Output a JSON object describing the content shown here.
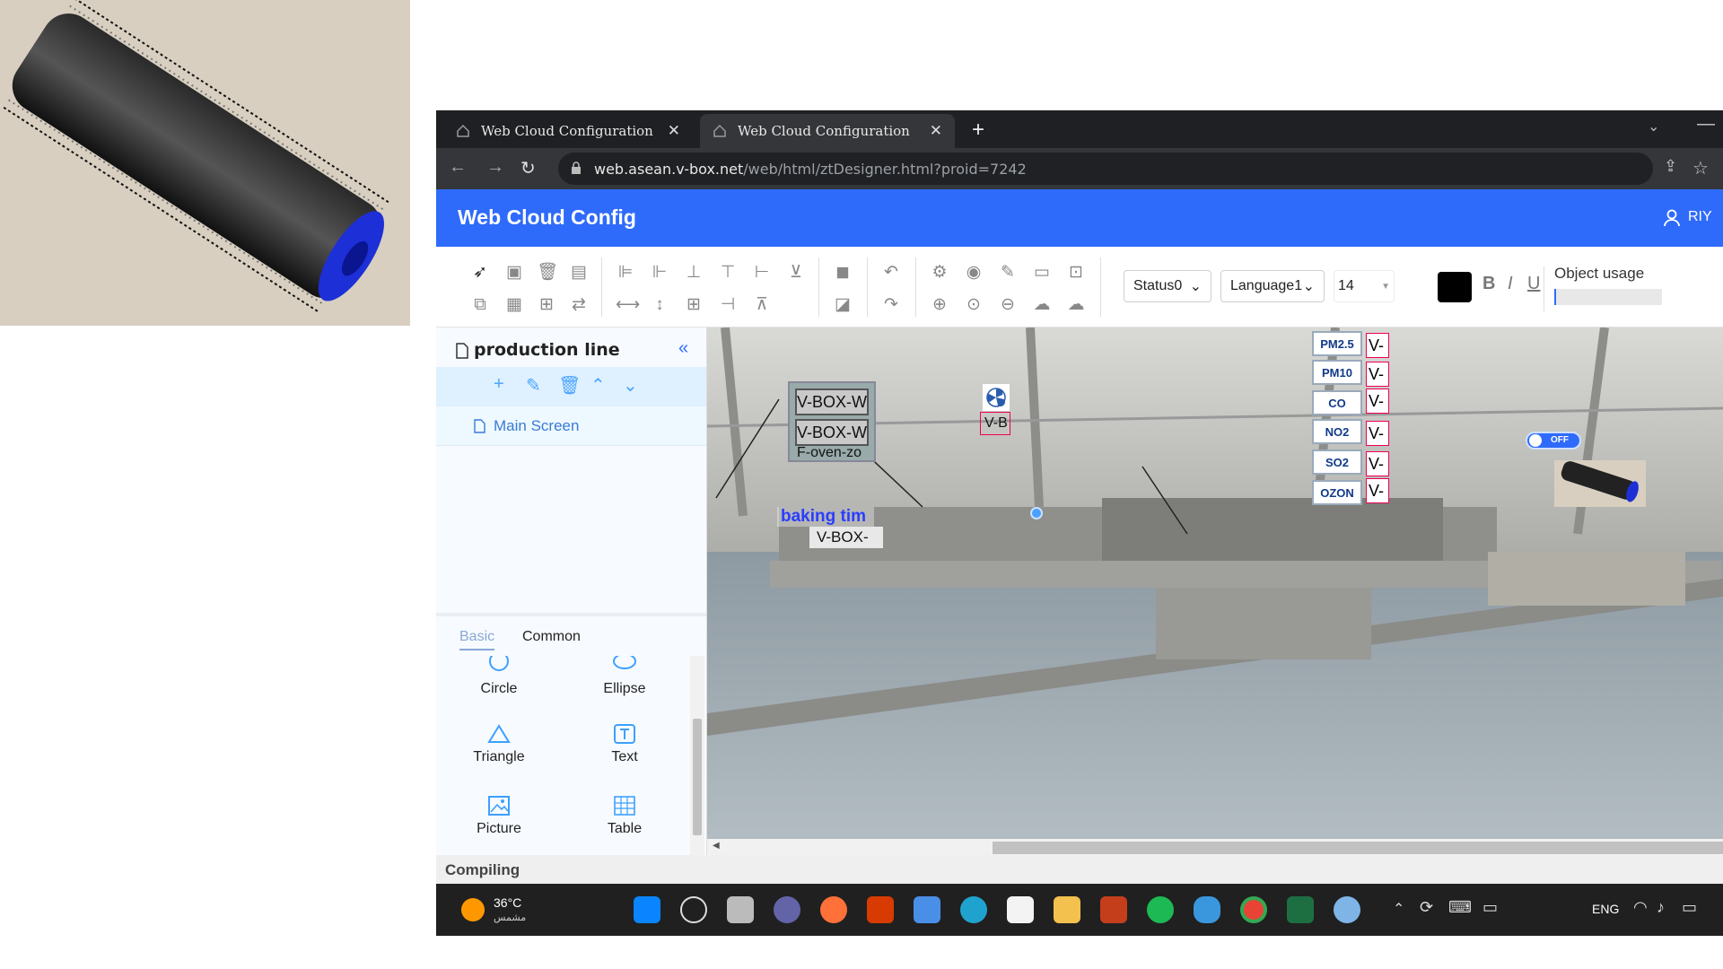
{
  "browser": {
    "tabs": [
      {
        "title": "Web Cloud Configuration",
        "active": false
      },
      {
        "title": "Web Cloud Configuration",
        "active": true
      }
    ],
    "url_host": "web.asean.v-box.net",
    "url_path": "/web/html/ztDesigner.html?proid=7242"
  },
  "app": {
    "title": "Web Cloud Config",
    "user": "RIY"
  },
  "toolbar": {
    "status_select": "Status0",
    "language_select": "Language1",
    "font_size": "14",
    "bold": "B",
    "italic": "I",
    "underline": "U",
    "usage_label": "Object usage",
    "accent_color": "#2f6bfb",
    "text_color": "#000000"
  },
  "left_panel": {
    "title": "production line",
    "pages": [
      {
        "label": "Main Screen"
      }
    ],
    "library_tabs": {
      "basic": "Basic",
      "common": "Common"
    },
    "shapes": [
      {
        "label": "Circle",
        "icon": "circle-icon"
      },
      {
        "label": "Ellipse",
        "icon": "ellipse-icon"
      },
      {
        "label": "Triangle",
        "icon": "triangle-icon"
      },
      {
        "label": "Text",
        "icon": "text-icon"
      },
      {
        "label": "Picture",
        "icon": "picture-icon"
      },
      {
        "label": "Table",
        "icon": "table-icon"
      }
    ]
  },
  "canvas": {
    "vbox_1": "V-BOX-W",
    "vbox_2": "V-BOX-W",
    "vbox_2b": "F-oven-zo",
    "vbox_3": "V-B",
    "baking_label": "baking tim",
    "vbox_4": "V-BOX-",
    "sensors": [
      {
        "label": "PM2.5",
        "value": "V-"
      },
      {
        "label": "PM10",
        "value": "V-"
      },
      {
        "label": "CO",
        "value": "V-"
      },
      {
        "label": "NO2",
        "value": "V-"
      },
      {
        "label": "SO2",
        "value": "V-"
      },
      {
        "label": "OZON",
        "value": "V-"
      }
    ],
    "toggle_text": "OFF"
  },
  "status": {
    "text": "Compiling"
  },
  "taskbar": {
    "temp": "36°C",
    "weather": "مشمس",
    "lang": "ENG"
  }
}
